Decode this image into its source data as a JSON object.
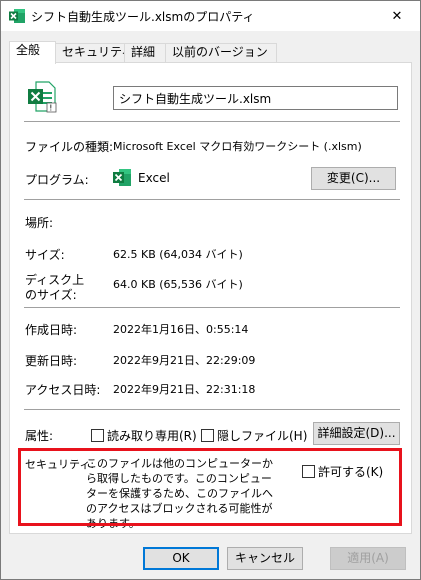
{
  "window": {
    "title": "シフト自動生成ツール.xlsmのプロパティ",
    "title_icon": "excel-icon",
    "close_glyph": "✕"
  },
  "tabs": [
    {
      "label": "全般",
      "active": true
    },
    {
      "label": "セキュリティ",
      "active": false
    },
    {
      "label": "詳細",
      "active": false
    },
    {
      "label": "以前のバージョン",
      "active": false
    }
  ],
  "general": {
    "file_name": "シフト自動生成ツール.xlsm",
    "file_type_label": "ファイルの種類:",
    "file_type_value": "Microsoft Excel マクロ有効ワークシート (.xlsm)",
    "program_label": "プログラム:",
    "program_value": "Excel",
    "change_button": "変更(C)...",
    "location_label": "場所:",
    "size_label": "サイズ:",
    "size_value": "62.5 KB (64,034 バイト)",
    "disk_size_label_1": "ディスク上",
    "disk_size_label_2": "のサイズ:",
    "disk_size_value": "64.0 KB (65,536 バイト)",
    "created_label": "作成日時:",
    "created_value": "2022年1月16日、0:55:14",
    "modified_label": "更新日時:",
    "modified_value": "2022年9月21日、22:29:09",
    "accessed_label": "アクセス日時:",
    "accessed_value": "2022年9月21日、22:31:18",
    "attributes_label": "属性:",
    "readonly_label": "読み取り専用(R)",
    "readonly_checked": false,
    "hidden_label": "隠しファイル(H)",
    "hidden_checked": false,
    "advanced_button": "詳細設定(D)...",
    "security_label": "セキュリティ:",
    "security_text": "このファイルは他のコンピューターから取得したものです。このコンピューターを保護するため、このファイルへのアクセスはブロックされる可能性があります。",
    "unblock_label": "許可する(K)",
    "unblock_checked": false,
    "highlight_color": "#e8121c"
  },
  "footer": {
    "ok": "OK",
    "cancel": "キャンセル",
    "apply": "適用(A)"
  }
}
